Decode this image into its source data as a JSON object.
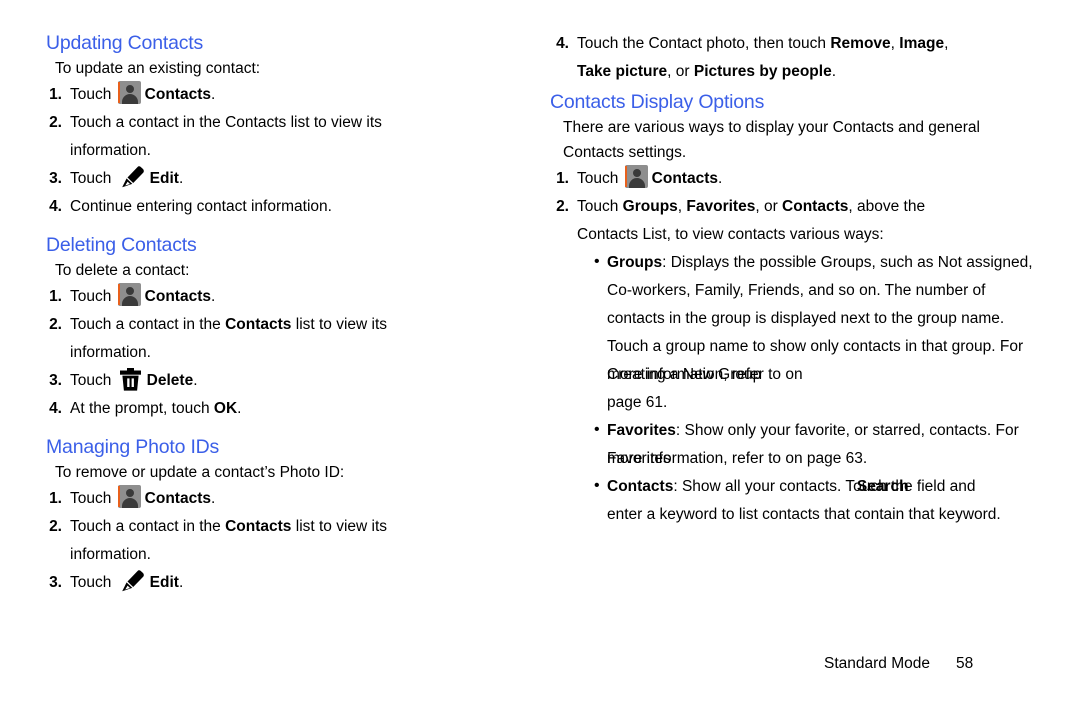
{
  "page": {
    "footer_label": "Standard Mode",
    "footer_page": "58",
    "heading_color": "#3b5fe8",
    "accent_color": "#e8601c"
  },
  "icons": {
    "contacts": "contacts-icon",
    "edit": "edit-pencil-icon",
    "delete": "delete-trash-icon",
    "bullet": "•"
  },
  "left_column": {
    "sections": [
      {
        "heading": "Updating Contacts",
        "lead": "To update an existing contact:",
        "steps": [
          {
            "num": "1.",
            "pre": "Touch ",
            "icon": "contacts",
            "bold": "Contacts",
            "post": "."
          },
          {
            "num": "2.",
            "line1": "Touch a contact in the Contacts list to view its",
            "line2": "information."
          },
          {
            "num": "3.",
            "pre": "Touch ",
            "icon": "edit",
            "bold": "Edit",
            "post": "."
          },
          {
            "num": "4.",
            "line1": "Continue entering contact information."
          }
        ]
      },
      {
        "heading": "Deleting Contacts",
        "lead": "To delete a contact:",
        "steps": [
          {
            "num": "1.",
            "pre": "Touch ",
            "icon": "contacts",
            "bold": "Contacts",
            "post": "."
          },
          {
            "num": "2.",
            "p1": "Touch a contact in the ",
            "b1": "Contacts",
            "p2": " list to view its",
            "line2": "information."
          },
          {
            "num": "3.",
            "pre": "Touch ",
            "icon": "delete",
            "bold": "Delete",
            "post": "."
          },
          {
            "num": "4.",
            "p1": "At the prompt, touch ",
            "b1": "OK",
            "p2": "."
          }
        ]
      },
      {
        "heading": "Managing Photo IDs",
        "lead": "To remove or update a contact’s Photo ID:",
        "steps": [
          {
            "num": "1.",
            "pre": "Touch ",
            "icon": "contacts",
            "bold": "Contacts",
            "post": "."
          },
          {
            "num": "2.",
            "p1": "Touch a contact in the ",
            "b1": "Contacts",
            "p2": " list to view its",
            "line2": "information."
          },
          {
            "num": "3.",
            "pre": "Touch ",
            "icon": "edit",
            "bold": "Edit",
            "post": "."
          }
        ]
      }
    ]
  },
  "right_column": {
    "continued_step": {
      "num": "4.",
      "l1_a": "Touch the Contact photo, then touch ",
      "l1_b1": "Remove",
      "l1_c": ", ",
      "l1_b2": "Image",
      "l1_d": ",",
      "l2_b1": "Take picture",
      "l2_a": ", or ",
      "l2_b2": "Pictures by people",
      "l2_c": "."
    },
    "section": {
      "heading": "Contacts Display Options",
      "lead_line1": "There are various ways to display your Contacts and general",
      "lead_line2": "Contacts settings.",
      "steps": [
        {
          "num": "1.",
          "pre": "Touch ",
          "icon": "contacts",
          "bold": "Contacts",
          "post": "."
        },
        {
          "num": "2.",
          "l1_a": "Touch ",
          "l1_b1": "Groups",
          "l1_b": ", ",
          "l1_b2": "Favorites",
          "l1_c": ", or ",
          "l1_b3": "Contacts",
          "l1_d": ", above the",
          "l2": "Contacts List, to view contacts various ways:"
        }
      ],
      "bullets": [
        {
          "label": "Groups",
          "l1_after": ": Displays the possible Groups, such as Not assigned,",
          "l2": "Co-workers, Family, Friends, and so on. The number of",
          "l3": "contacts in the group is displayed next to the group name.",
          "l4": "Touch a group name to show only contacts in that group. For",
          "l5_a": "more information, refer to ",
          "l5_overlap_italic": "Creating a New Group",
          "l5_b": " on",
          "l6": "page 61."
        },
        {
          "label": "Favorites",
          "l1_after": ": Show only your favorite, or starred, contacts. For",
          "l2_a": "more information, refer to ",
          "l2_overlap_italic": "Favorites",
          "l2_b": " on page 63."
        },
        {
          "label": "Contacts",
          "l1_a": ": Show all your contacts. Touch the ",
          "l1_overlap_bold": "Search",
          "l1_b": " field and",
          "l2": "enter a keyword to list contacts that contain that keyword."
        }
      ]
    }
  }
}
